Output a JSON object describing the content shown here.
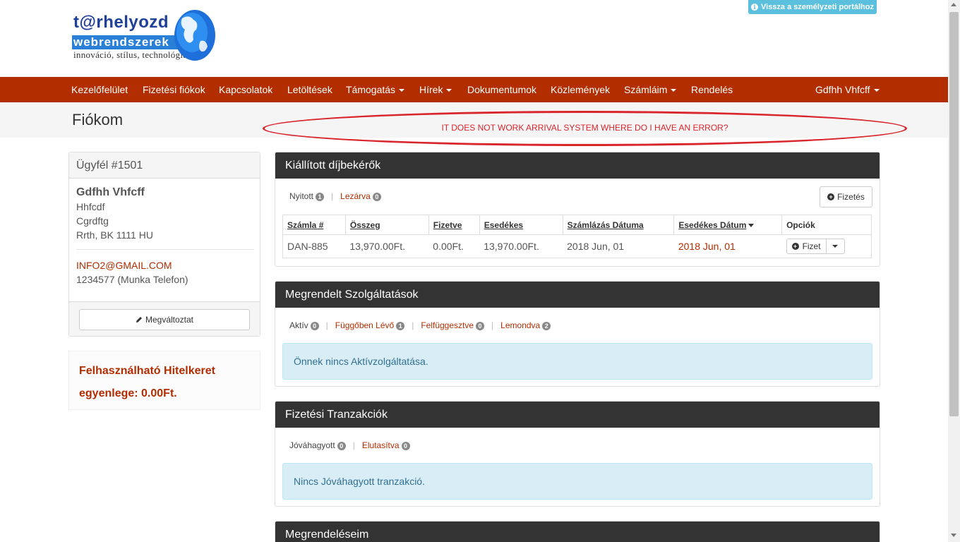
{
  "logo": {
    "line1": "t@rhelyozd",
    "line2": "webrendszerek",
    "line3": "innováció, stílus, technológia"
  },
  "portal_button": "Vissza a személyzeti portálhoz",
  "nav": {
    "items": [
      "Kezelőfelület",
      "Fizetési fiókok",
      "Kapcsolatok",
      "Letöltések",
      "Támogatás",
      "Hírek",
      "Dokumentumok",
      "Közlemények",
      "Számláim",
      "Rendelés"
    ],
    "user": "Gdfhh Vhfcff"
  },
  "page": {
    "title": "Fiókom",
    "annotation": "IT DOES NOT WORK ARRIVAL SYSTEM WHERE DO I HAVE AN ERROR?"
  },
  "client": {
    "header": "Ügyfél #1501",
    "name": "Gdfhh Vhfcff",
    "company": "Hhfcdf",
    "street": "Cgrdftg",
    "city": "Rrth, BK 1111 HU",
    "email": "INFO2@GMAIL.COM",
    "phone": "1234577 (Munka Telefon)",
    "edit_button": "Megváltoztat"
  },
  "credit": {
    "text": "Felhasználható Hitelkeret egyenlege: 0.00Ft."
  },
  "invoices": {
    "title": "Kiállított díjbekérők",
    "filters": [
      {
        "label": "Nyitott",
        "count": "1"
      },
      {
        "label": "Lezárva",
        "count": "0"
      }
    ],
    "pay_button": "Fizetés",
    "columns": [
      "Számla #",
      "Összeg",
      "Fizetve",
      "Esedékes",
      "Számlázás Dátuma",
      "Esedékes Dátum",
      "Opciók"
    ],
    "rows": [
      {
        "number": "DAN-885",
        "amount": "13,970.00Ft.",
        "paid": "0.00Ft.",
        "due": "13,970.00Ft.",
        "invoice_date": "2018 Jun, 01",
        "due_date": "2018 Jun, 01",
        "action": "Fizet"
      }
    ]
  },
  "services": {
    "title": "Megrendelt Szolgáltatások",
    "filters": [
      {
        "label": "Aktív",
        "count": "0"
      },
      {
        "label": "Függőben Lévő",
        "count": "1"
      },
      {
        "label": "Felfüggesztve",
        "count": "0"
      },
      {
        "label": "Lemondva",
        "count": "2"
      }
    ],
    "empty": "Önnek nincs Aktívzolgáltatása."
  },
  "transactions": {
    "title": "Fizetési Tranzakciók",
    "filters": [
      {
        "label": "Jóváhagyott",
        "count": "0"
      },
      {
        "label": "Elutasítva",
        "count": "0"
      }
    ],
    "empty": "Nincs Jóváhagyott tranzakció."
  },
  "orders": {
    "title": "Megrendeléseim"
  },
  "colors": {
    "brand": "#b22d00",
    "panel_header": "#333333",
    "info": "#5bc0de",
    "annotation": "#d9252c"
  }
}
